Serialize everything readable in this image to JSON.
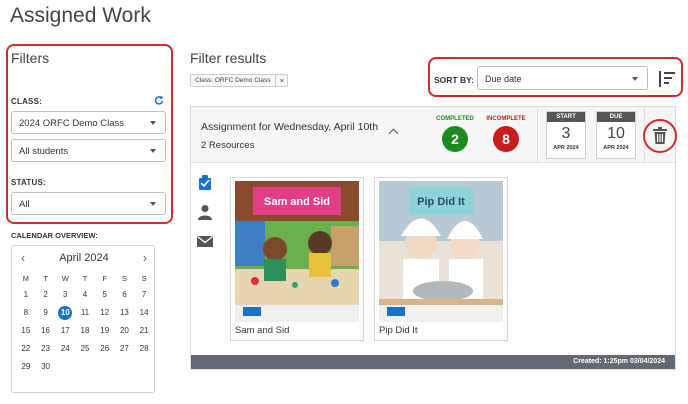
{
  "page": {
    "title": "Assigned Work"
  },
  "filters": {
    "title": "Filters",
    "class_label": "CLASS:",
    "class_value": "2024 ORFC Demo Class",
    "students_value": "All students",
    "status_label": "STATUS:",
    "status_value": "All"
  },
  "calendar": {
    "label": "CALENDAR OVERVIEW:",
    "month": "April 2024",
    "prev": "‹",
    "next": "›",
    "weekdays": [
      "M",
      "T",
      "W",
      "T",
      "F",
      "S",
      "S"
    ],
    "days": [
      "1",
      "2",
      "3",
      "4",
      "5",
      "6",
      "7",
      "8",
      "9",
      "10",
      "11",
      "12",
      "13",
      "14",
      "15",
      "16",
      "17",
      "18",
      "19",
      "20",
      "21",
      "22",
      "23",
      "24",
      "25",
      "26",
      "27",
      "28",
      "29",
      "30"
    ],
    "selected": "10"
  },
  "results": {
    "title": "Filter results",
    "chip_label": "Class: ORFC Demo Class",
    "chip_close": "×",
    "sort_label": "SORT BY:",
    "sort_value": "Due date"
  },
  "assignment": {
    "title": "Assignment for Wednesday, April 10th",
    "resources": "2 Resources",
    "completed_label": "COMPLETED",
    "completed_count": "2",
    "incomplete_label": "INCOMPLETE",
    "incomplete_count": "8",
    "start_label": "START",
    "start_day": "3",
    "start_month": "APR 2024",
    "due_label": "DUE",
    "due_day": "10",
    "due_month": "APR 2024",
    "books": [
      {
        "name": "Sam and Sid",
        "cover_title": "Sam and Sid"
      },
      {
        "name": "Pip Did It",
        "cover_title": "Pip Did It"
      }
    ],
    "created": "Created:   1:25pm   03/04/2024"
  },
  "colors": {
    "accent": "#1a73c4",
    "highlight": "#d42a2a",
    "completed": "#1f8a1f",
    "incomplete": "#c81d1d",
    "footer": "#616a72"
  }
}
